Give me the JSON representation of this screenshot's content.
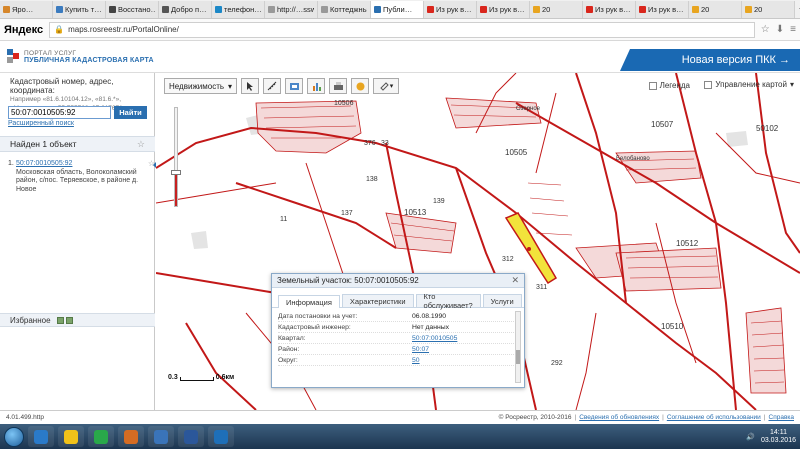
{
  "browser": {
    "tabs": [
      {
        "label": "Яро…",
        "color": "#d6862a"
      },
      {
        "label": "Купить т…",
        "color": "#3b7bbf"
      },
      {
        "label": "Восстано…",
        "color": "#444444"
      },
      {
        "label": "Добро п…",
        "color": "#555555"
      },
      {
        "label": "телефон…",
        "color": "#1c88c7"
      },
      {
        "label": "http://…ssword",
        "color": "#999999"
      },
      {
        "label": "Коттеджный…",
        "color": "#999999"
      },
      {
        "label": "Публи…",
        "color": "#2a6fb0",
        "active": true
      },
      {
        "label": "Из рук в…",
        "color": "#d9261c"
      },
      {
        "label": "Из рук в…",
        "color": "#d9261c"
      },
      {
        "label": "20",
        "color": "#e8a520"
      },
      {
        "label": "Из рук в…",
        "color": "#d9261c"
      },
      {
        "label": "Из рук в…",
        "color": "#d9261c"
      },
      {
        "label": "20",
        "color": "#e8a520"
      },
      {
        "label": "20",
        "color": "#e8a520"
      }
    ],
    "yandex_logo": "Яндекс",
    "url": "maps.rosreestr.ru/PortalOnline/"
  },
  "header": {
    "portal_line1": "ПОРТАЛ УСЛУГ",
    "portal_line2": "ПУБЛИЧНАЯ КАДАСТРОВАЯ КАРТА",
    "new_version": "Новая версия ПКК →"
  },
  "search": {
    "hint_title": "Кадастровый номер, адрес, координата:",
    "hint_example": "Например «81.6.10104.12», «81.6.*», «Москва» или «55.755768, 37.617671»",
    "value": "50:07:0010505:92",
    "button": "Найти",
    "advanced": "Расширенный поиск"
  },
  "results": {
    "found": "Найден 1 объект",
    "items": [
      {
        "num": "1.",
        "id": "50:07:0010505:92",
        "address": "Московская область, Волоколамский район, с/пос. Теряевское, в районе д. Новое"
      }
    ]
  },
  "favorites": {
    "label": "Избранное"
  },
  "map": {
    "layer_select": "Недвижимость",
    "legend": "Легенда",
    "control": "Управление картой",
    "scale_left": "0.3",
    "scale_right": "0.6км",
    "zoom_level": 0.35,
    "labels": [
      "10506",
      "10505",
      "10513",
      "10512",
      "10510",
      "10507",
      "50102",
      "376",
      "33",
      "138",
      "139",
      "137",
      "312",
      "311",
      "292",
      "11",
      "Белобаново",
      "Озерное"
    ]
  },
  "popup": {
    "title": "Земельный участок: 50:07:0010505:92",
    "tabs": [
      "Информация",
      "Характеристики",
      "Кто обслуживает?",
      "Услуги"
    ],
    "rows": [
      {
        "key": "Дата постановки на учет:",
        "value": "06.08.1990",
        "link": false
      },
      {
        "key": "Кадастровый инженер:",
        "value": "Нет данных",
        "link": false
      },
      {
        "key": "Квартал:",
        "value": "50:07:0010505",
        "link": true
      },
      {
        "key": "Район:",
        "value": "50:07",
        "link": true
      },
      {
        "key": "Округ:",
        "value": "50",
        "link": true
      }
    ]
  },
  "footer": {
    "version": "4.01.499.http",
    "copyright": "© Росреестр, 2010-2016",
    "link1": "Сведения об обновлениях",
    "link2": "Соглашение об использовании",
    "link3": "Справка"
  },
  "taskbar": {
    "time": "14:11",
    "date": "03.03.2016",
    "icons": [
      "#2a7ac9",
      "#f0c21a",
      "#29a84a",
      "#d56c23",
      "#3a74b9",
      "#2b579a",
      "#1e6fb8"
    ]
  }
}
